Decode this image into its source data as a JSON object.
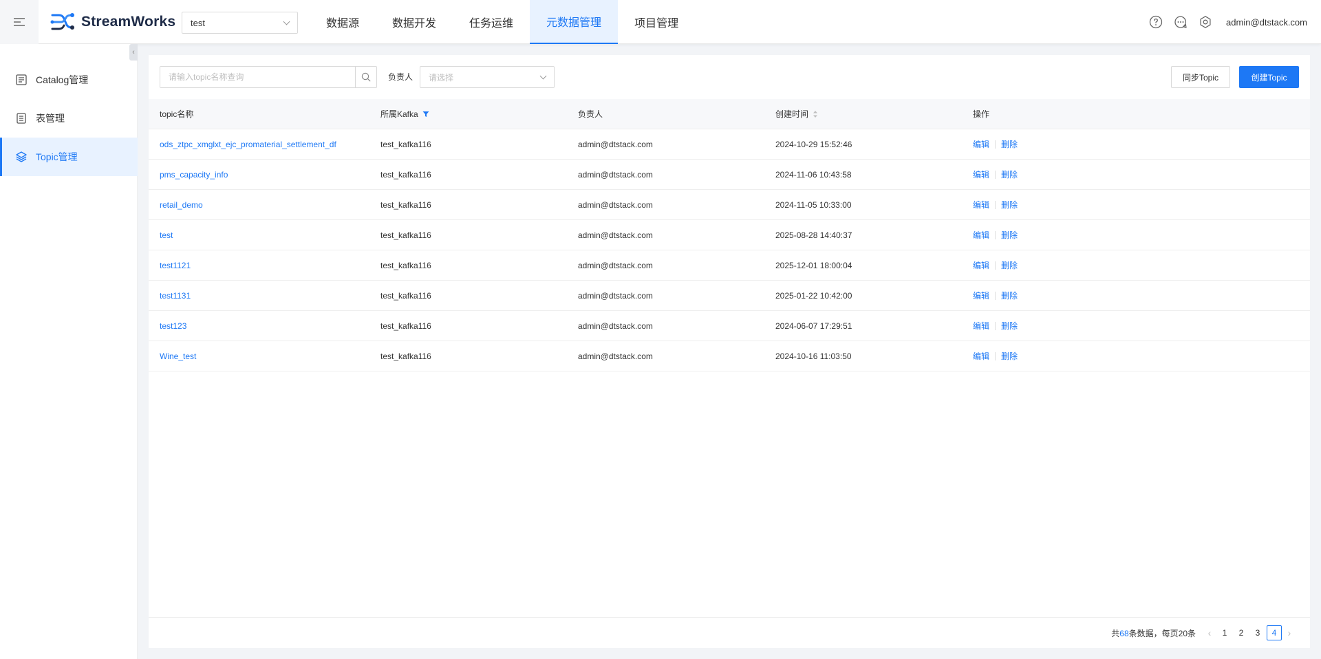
{
  "header": {
    "app_name": "StreamWorks",
    "project": "test",
    "nav": [
      {
        "label": "数据源",
        "active": false
      },
      {
        "label": "数据开发",
        "active": false
      },
      {
        "label": "任务运维",
        "active": false
      },
      {
        "label": "元数据管理",
        "active": true
      },
      {
        "label": "项目管理",
        "active": false
      }
    ],
    "icons": [
      "help-icon",
      "message-icon",
      "settings-icon"
    ],
    "user": "admin@dtstack.com"
  },
  "sidebar": {
    "items": [
      {
        "label": "Catalog管理",
        "icon": "catalog-icon",
        "active": false
      },
      {
        "label": "表管理",
        "icon": "table-icon",
        "active": false
      },
      {
        "label": "Topic管理",
        "icon": "layers-icon",
        "active": true
      }
    ]
  },
  "toolbar": {
    "search_placeholder": "请输入topic名称查询",
    "owner_label": "负责人",
    "owner_placeholder": "请选择",
    "sync_label": "同步Topic",
    "create_label": "创建Topic"
  },
  "table": {
    "columns": [
      "topic名称",
      "所属Kafka",
      "负责人",
      "创建时间",
      "操作"
    ],
    "edit_label": "编辑",
    "delete_label": "删除",
    "rows": [
      {
        "name": "ods_ztpc_xmglxt_ejc_promaterial_settlement_df",
        "kafka": "test_kafka116",
        "owner": "admin@dtstack.com",
        "created": "2024-10-29 15:52:46"
      },
      {
        "name": "pms_capacity_info",
        "kafka": "test_kafka116",
        "owner": "admin@dtstack.com",
        "created": "2024-11-06 10:43:58"
      },
      {
        "name": "retail_demo",
        "kafka": "test_kafka116",
        "owner": "admin@dtstack.com",
        "created": "2024-11-05 10:33:00"
      },
      {
        "name": "test",
        "kafka": "test_kafka116",
        "owner": "admin@dtstack.com",
        "created": "2025-08-28 14:40:37"
      },
      {
        "name": "test1121",
        "kafka": "test_kafka116",
        "owner": "admin@dtstack.com",
        "created": "2025-12-01 18:00:04"
      },
      {
        "name": "test1131",
        "kafka": "test_kafka116",
        "owner": "admin@dtstack.com",
        "created": "2025-01-22 10:42:00"
      },
      {
        "name": "test123",
        "kafka": "test_kafka116",
        "owner": "admin@dtstack.com",
        "created": "2024-06-07 17:29:51"
      },
      {
        "name": "Wine_test",
        "kafka": "test_kafka116",
        "owner": "admin@dtstack.com",
        "created": "2024-10-16 11:03:50"
      }
    ]
  },
  "pagination": {
    "total_prefix": "共",
    "total": "68",
    "total_suffix": "条数据，每页20条",
    "pages": [
      "1",
      "2",
      "3",
      "4"
    ],
    "current": "4"
  },
  "colors": {
    "primary": "#1d78f5",
    "active_bg": "#e8f2ff"
  }
}
